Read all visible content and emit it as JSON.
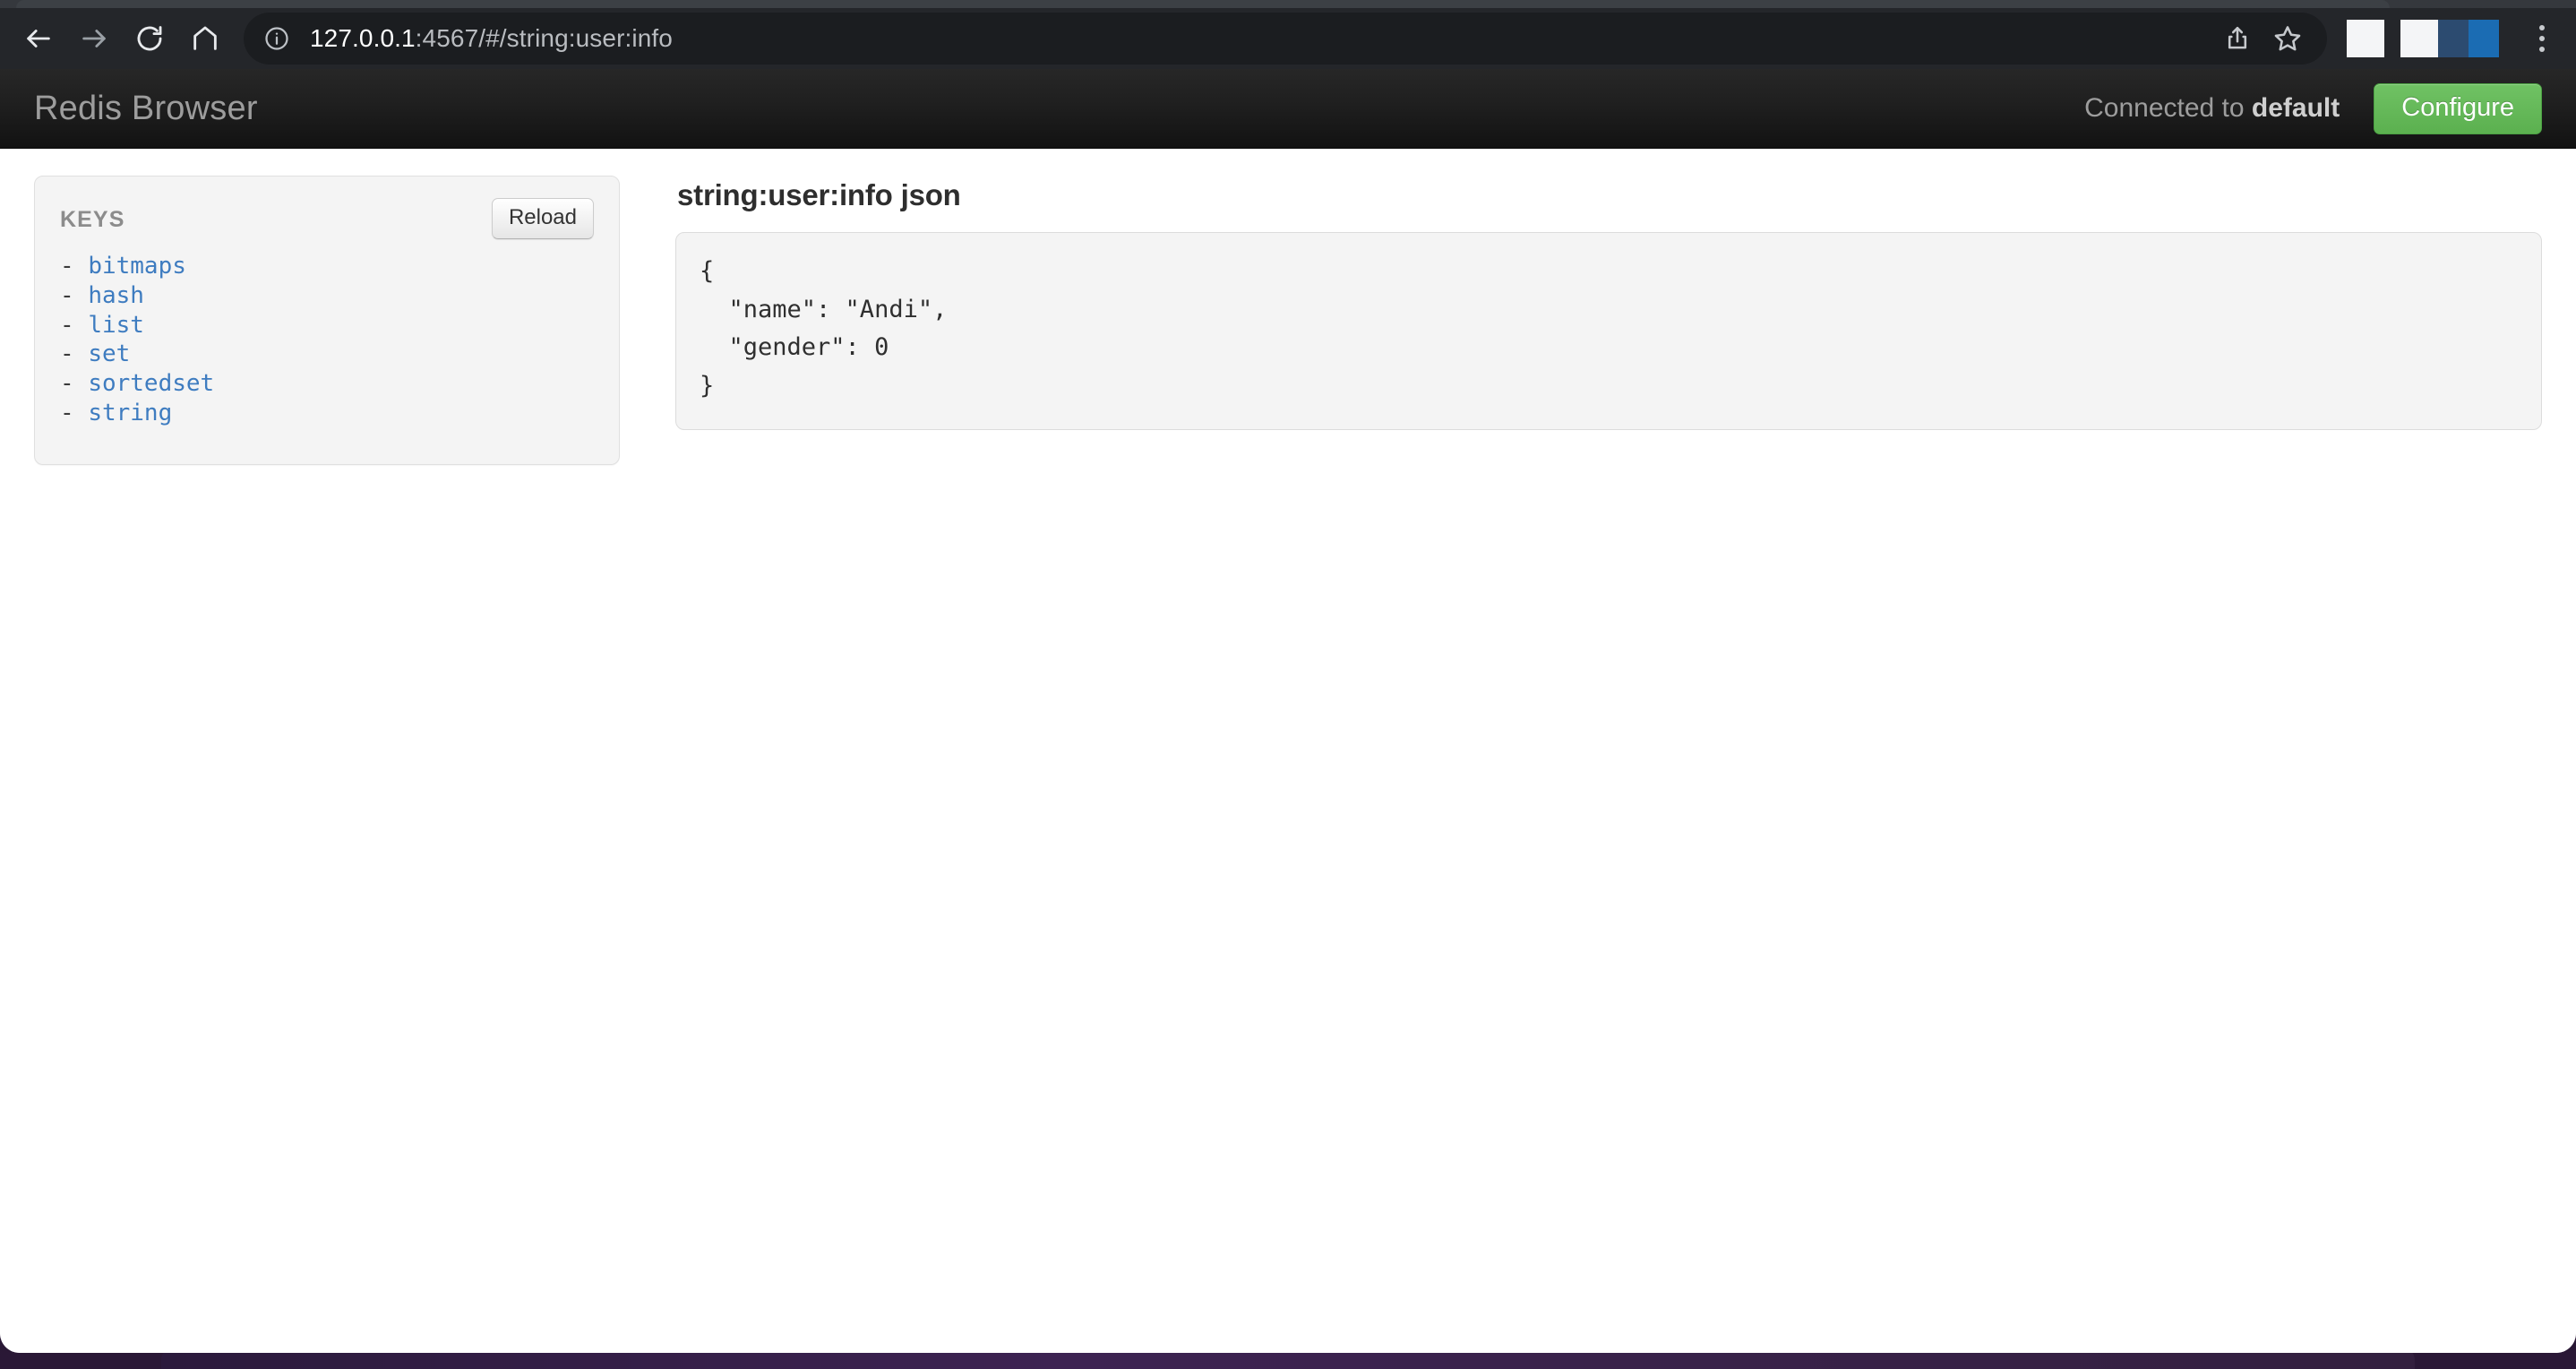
{
  "browser": {
    "back_label": "Back",
    "forward_label": "Forward",
    "reload_label": "Reload page",
    "home_label": "Home",
    "url_host": "127.0.0.1",
    "url_rest": ":4567/#/string:user:info",
    "share_label": "Share",
    "bookmark_label": "Bookmark this page",
    "menu_label": "Customize and control",
    "site_info_label": "Site information"
  },
  "navbar": {
    "brand": "Redis Browser",
    "connection_prefix": "Connected to ",
    "connection_name": "default",
    "configure_label": "Configure",
    "configure_color": "#5bb04f"
  },
  "sidebar": {
    "title": "KEYS",
    "reload_label": "Reload",
    "bullet": "- ",
    "key_color": "#3e7cc0",
    "items": [
      {
        "label": "bitmaps"
      },
      {
        "label": "hash"
      },
      {
        "label": "list"
      },
      {
        "label": "set"
      },
      {
        "label": "sortedset"
      },
      {
        "label": "string"
      }
    ]
  },
  "main": {
    "heading": "string:user:info json",
    "json_value": "{\n  \"name\": \"Andi\",\n  \"gender\": 0\n}"
  }
}
